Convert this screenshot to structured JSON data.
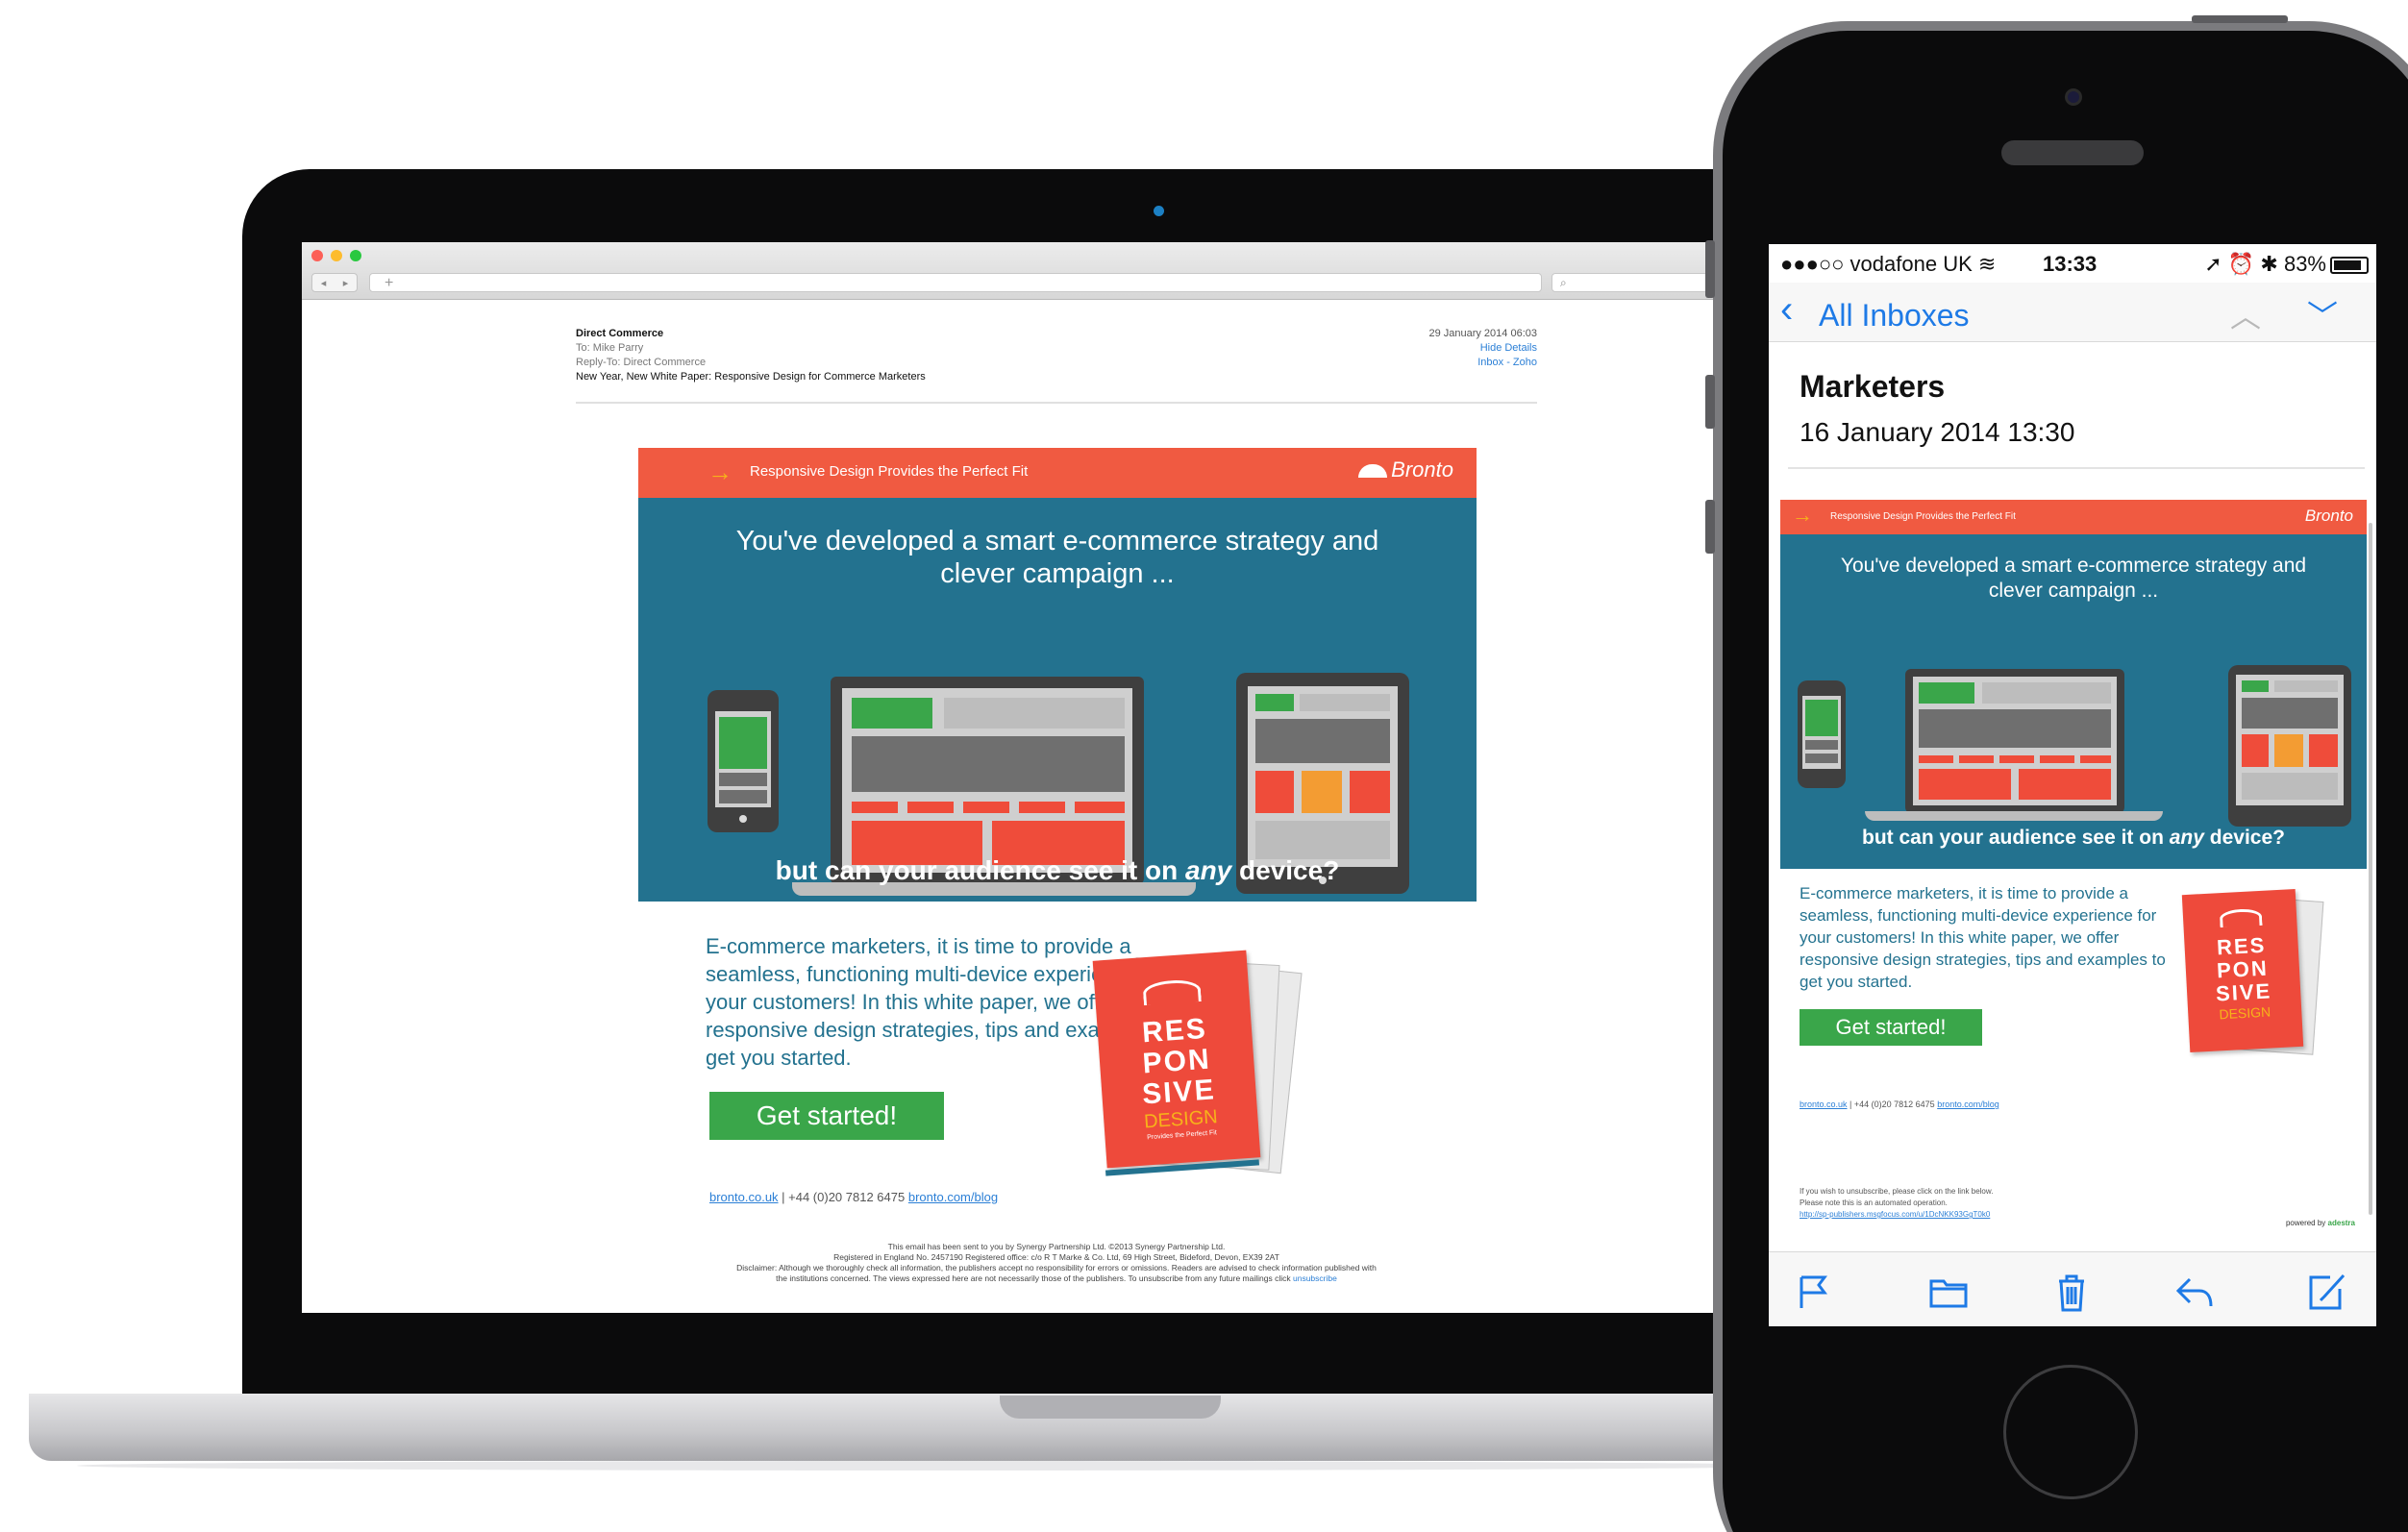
{
  "laptop": {
    "mail": {
      "from": "Direct Commerce",
      "to": "To:  Mike Parry",
      "reply_to": "Reply-To:  Direct Commerce",
      "subject": "New Year, New White Paper: Responsive Design for Commerce Marketers",
      "date": "29 January 2014 06:03",
      "hide_details": "Hide Details",
      "mailbox": "Inbox - Zoho"
    }
  },
  "newsletter": {
    "top_bar_text": "Responsive Design Provides the Perfect Fit",
    "brand": "Bronto",
    "headline": "You've developed a smart e-commerce strategy and clever campaign ...",
    "sub_before": "but can your audience see it on ",
    "sub_em": "any",
    "sub_after": " device?",
    "body": "E-commerce marketers, it is time to provide a seamless, functioning multi-device experience for your customers! In this white paper, we offer responsive design strategies, tips and examples to get you started.",
    "cta": "Get started!",
    "link1": "bronto.co.uk",
    "link_sep": " | +44 (0)20 7812 6475 ",
    "link2": "bronto.com/blog",
    "booklet": {
      "line1": "RES",
      "line2": "PON",
      "line3": "SIVE",
      "line4": "DESIGN",
      "tagline": "Provides the Perfect Fit"
    },
    "footer": {
      "line1": "This email has been sent to you by Synergy Partnership Ltd. ©2013 Synergy Partnership Ltd.",
      "line2": "Registered in England No. 2457190 Registered office: c/o R T Marke & Co. Ltd, 69 High Street, Bideford, Devon, EX39 2AT",
      "line3": "Disclaimer: Although we thoroughly check all information, the publishers accept no responsibility for errors or omissions. Readers are advised to check information published with",
      "line4": "the institutions concerned. The views expressed here are not necessarily those of the publishers. To unsubscribe from any future mailings click ",
      "unsubscribe": "unsubscribe"
    }
  },
  "phone": {
    "status": {
      "carrier": "●●●○○ vodafone UK",
      "time": "13:33",
      "battery": "83%"
    },
    "nav": {
      "back_label": "All Inboxes"
    },
    "subject_tail": "Marketers",
    "date": "16 January 2014 13:30",
    "footer": {
      "line1": "If you wish to unsubscribe, please click on the link below.",
      "line2": "Please note this is an automated operation.",
      "link": "http://sp-publishers.msgfocus.com/u/1DcNKK93GgT0k0",
      "powered_by": "powered by ",
      "powered_brand": "adestra"
    }
  },
  "colors": {
    "brand_orange": "#f05a41",
    "brand_teal": "#23728f",
    "brand_green": "#3aa64a",
    "ios_blue": "#1e7ae6"
  },
  "icons": [
    "search-icon",
    "flag-icon",
    "folder-icon",
    "trash-icon",
    "reply-icon",
    "compose-icon",
    "chevron-left-icon",
    "chevron-up-icon",
    "chevron-down-icon",
    "wifi-icon",
    "battery-icon"
  ]
}
